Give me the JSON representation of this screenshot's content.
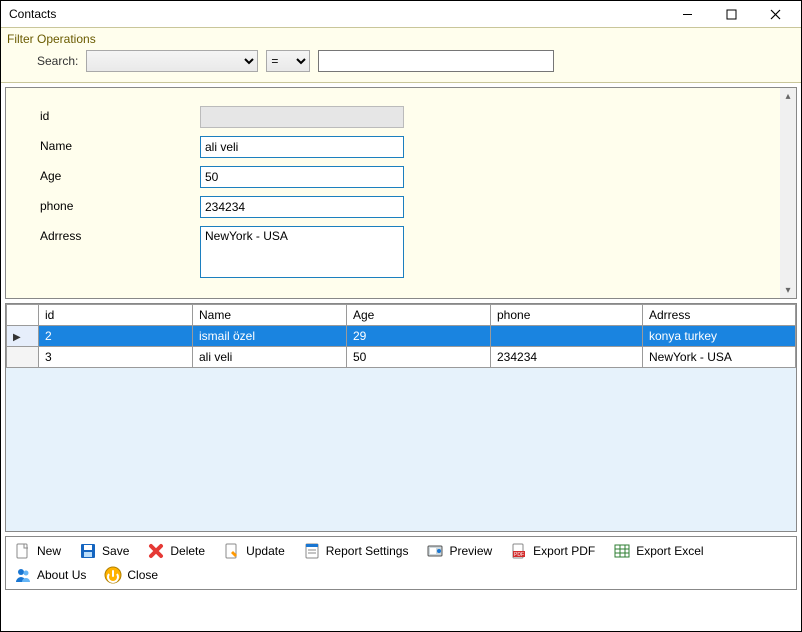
{
  "window": {
    "title": "Contacts"
  },
  "filter": {
    "group_label": "Filter Operations",
    "search_label": "Search:",
    "field": "",
    "op": "=",
    "value": ""
  },
  "form": {
    "labels": {
      "id": "id",
      "name": "Name",
      "age": "Age",
      "phone": "phone",
      "address": "Adrress"
    },
    "values": {
      "id": "",
      "name": "ali veli",
      "age": "50",
      "phone": "234234",
      "address": "NewYork - USA"
    }
  },
  "grid": {
    "columns": [
      "id",
      "Name",
      "Age",
      "phone",
      "Adrress"
    ],
    "rows": [
      {
        "selected": true,
        "cells": [
          "2",
          "ismail özel",
          "29",
          "",
          "konya turkey"
        ]
      },
      {
        "selected": false,
        "cells": [
          "3",
          "ali veli",
          "50",
          "234234",
          "NewYork - USA"
        ]
      }
    ]
  },
  "toolbar": {
    "row1": [
      {
        "key": "new",
        "label": "New"
      },
      {
        "key": "save",
        "label": "Save"
      },
      {
        "key": "delete",
        "label": "Delete"
      },
      {
        "key": "update",
        "label": "Update"
      },
      {
        "key": "report",
        "label": "Report Settings"
      },
      {
        "key": "preview",
        "label": "Preview"
      },
      {
        "key": "pdf",
        "label": "Export PDF"
      },
      {
        "key": "excel",
        "label": "Export Excel"
      }
    ],
    "row2": [
      {
        "key": "about",
        "label": "About Us"
      },
      {
        "key": "close",
        "label": "Close"
      }
    ]
  }
}
